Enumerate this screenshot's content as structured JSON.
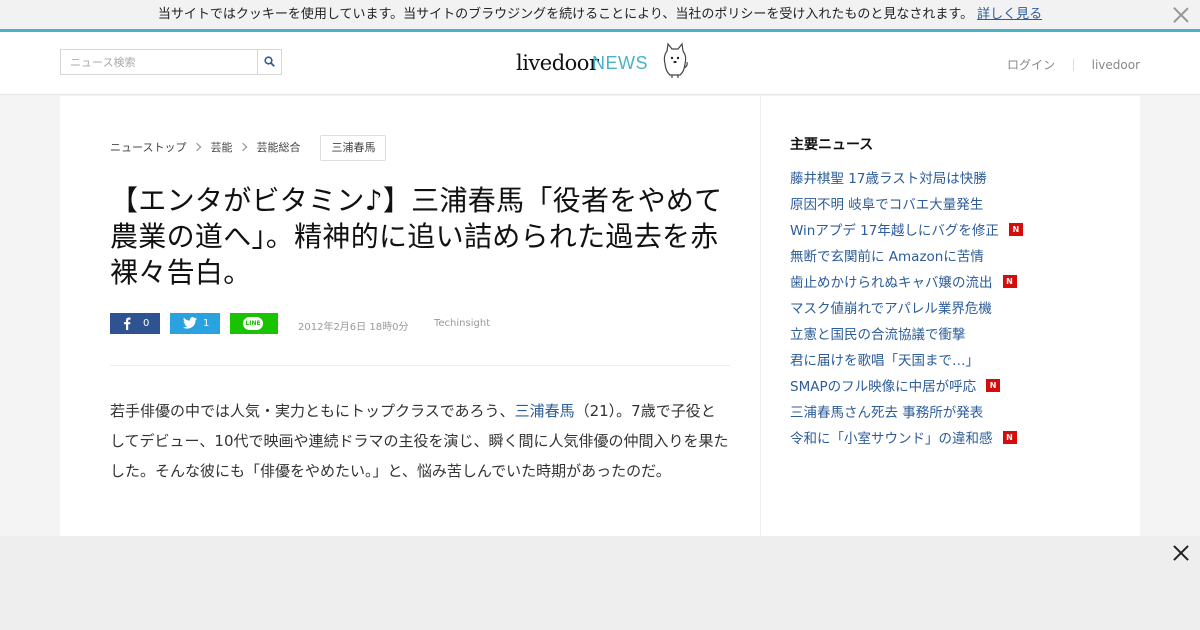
{
  "cookie_bar": {
    "text": "当サイトではクッキーを使用しています。当サイトのブラウジングを続けることにより、当社のポリシーを受け入れたものと見なされます。",
    "link_label": "詳しく見る"
  },
  "header": {
    "search_placeholder": "ニュース検索",
    "logo_main": "livedoor",
    "logo_news": "NEWS",
    "nav": {
      "login": "ログイン",
      "livedoor": "livedoor"
    }
  },
  "breadcrumb": {
    "items": [
      "ニューストップ",
      "芸能",
      "芸能総合"
    ],
    "tag": "三浦春馬"
  },
  "article": {
    "title": "【エンタがビタミン♪】三浦春馬「役者をやめて農業の道へ」。精神的に追い詰められた過去を赤裸々告白。",
    "share": {
      "facebook_count": "0",
      "twitter_count": "1",
      "line_label": "LINE"
    },
    "date": "2012年2月6日 18時0分",
    "source": "Techinsight",
    "body": {
      "before_link": "若手俳優の中では人気・実力ともにトップクラスであろう、",
      "link_text": "三浦春馬",
      "after_link": "（21）。7歳で子役としてデビュー、10代で映画や連続ドラマの主役を演じ、瞬く間に人気俳優の仲間入りを果たした。そんな彼にも「俳優をやめたい。」と、悩み苦しんでいた時期があったのだ。"
    }
  },
  "sidebar": {
    "title": "主要ニュース",
    "items": [
      {
        "label": "藤井棋聖 17歳ラスト対局は快勝",
        "is_new": false
      },
      {
        "label": "原因不明 岐阜でコバエ大量発生",
        "is_new": false
      },
      {
        "label": "Winアプデ 17年越しにバグを修正",
        "is_new": true
      },
      {
        "label": "無断で玄関前に Amazonに苦情",
        "is_new": false
      },
      {
        "label": "歯止めかけられぬキャバ嬢の流出",
        "is_new": true
      },
      {
        "label": "マスク値崩れでアパレル業界危機",
        "is_new": false
      },
      {
        "label": "立憲と国民の合流協議で衝撃",
        "is_new": false
      },
      {
        "label": "君に届けを歌唱「天国まで…」",
        "is_new": false
      },
      {
        "label": "SMAPのフル映像に中居が呼応",
        "is_new": true
      },
      {
        "label": "三浦春馬さん死去 事務所が発表",
        "is_new": false
      },
      {
        "label": "令和に「小室サウンド」の違和感",
        "is_new": true
      }
    ],
    "new_badge": "N"
  },
  "colors": {
    "accent": "#48b3c6",
    "link": "#2c5c9a",
    "facebook": "#2f5391",
    "twitter": "#2aa2e0",
    "line": "#1ac300",
    "new_badge": "#d40c0c"
  }
}
